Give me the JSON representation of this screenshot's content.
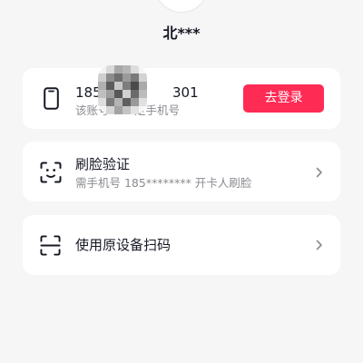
{
  "profile": {
    "username": "北***"
  },
  "account_card": {
    "icon": "phone-icon",
    "phone_prefix": "185",
    "phone_suffix": "301",
    "subtitle_prefix": "该账号",
    "subtitle_suffix": "定手机号",
    "login_label": "去登录"
  },
  "options": [
    {
      "icon": "face-scan-icon",
      "title": "刷脸验证",
      "subtitle": "需手机号 185******** 开卡人刷脸"
    },
    {
      "icon": "qr-scan-icon",
      "title": "使用原设备扫码"
    }
  ],
  "colors": {
    "accent": "#FE2C55",
    "background": "#F6F6F6",
    "card": "#FFFFFF",
    "subtitle": "#8A8B91"
  }
}
